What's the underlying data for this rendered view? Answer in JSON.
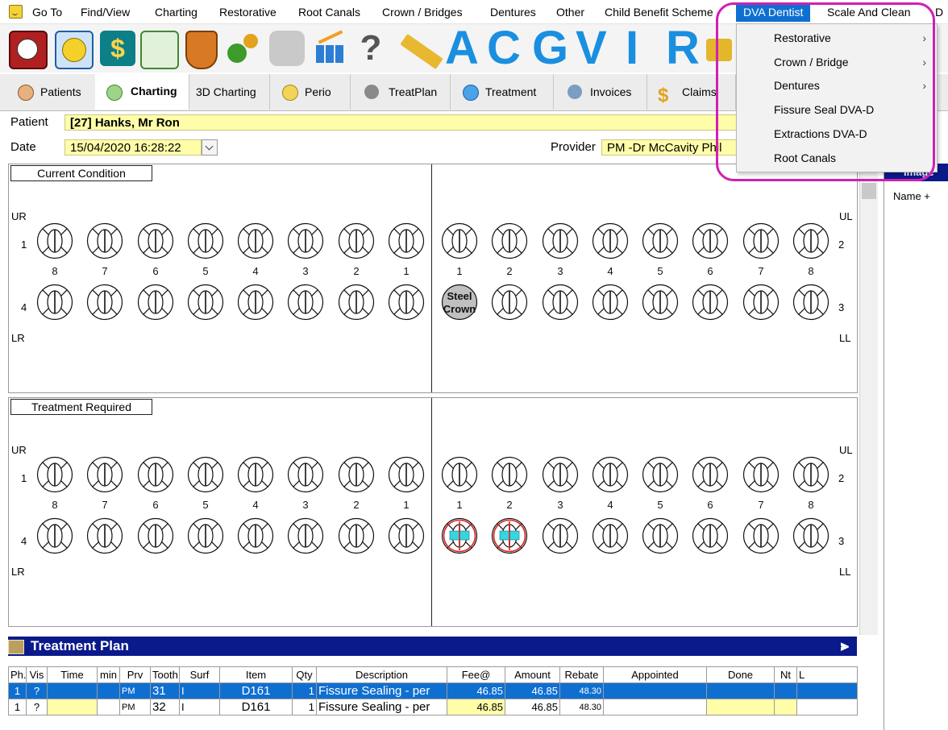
{
  "menubar": {
    "items": [
      "Go To",
      "Find/View",
      "Charting",
      "Restorative",
      "Root Canals",
      "Crown / Bridges",
      "Dentures",
      "Other",
      "Child Benefit Scheme",
      "DVA Dentist",
      "Scale And Clean",
      "D"
    ],
    "active": "DVA Dentist"
  },
  "toolbar": {
    "icons": [
      "appointment-clock-icon",
      "patient-smiley-icon",
      "billing-dollar-icon",
      "mail-icon",
      "shield-icon",
      "settings-gears-icon",
      "dental-teeth-icon",
      "report-chart-icon",
      "help-question-icon",
      "pencil-icon",
      "crown-icon"
    ],
    "letters": [
      "A",
      "C",
      "G",
      "V",
      "I",
      "R"
    ]
  },
  "tabs": [
    {
      "label": "Patients",
      "icon": "patient-person-icon"
    },
    {
      "label": "Charting",
      "icon": "tooth-green-icon",
      "active": true
    },
    {
      "label": "3D Charting"
    },
    {
      "label": "Perio",
      "icon": "tooth-yellow-icon"
    },
    {
      "label": "TreatPlan",
      "icon": "treatplan-icon"
    },
    {
      "label": "Treatment",
      "icon": "tooth-blue-icon"
    },
    {
      "label": "Invoices",
      "icon": "invoice-icon"
    },
    {
      "label": "Claims",
      "icon": "claims-dollar-icon"
    }
  ],
  "patient": {
    "label": "Patient",
    "value": "[27] Hanks, Mr Ron"
  },
  "date": {
    "label": "Date",
    "value": "15/04/2020 16:28:22"
  },
  "provider": {
    "label": "Provider",
    "value": "PM -Dr McCavity Phil"
  },
  "chart": {
    "current_title": "Current Condition",
    "required_title": "Treatment Required",
    "quadrants": {
      "ur": "UR",
      "ul": "UL",
      "lr": "LR",
      "ll": "LL"
    },
    "row_numbers": {
      "upper_right": "1",
      "upper_left": "2",
      "lower_left": "3",
      "lower_right": "4"
    },
    "tooth_numbers_right": [
      "8",
      "7",
      "6",
      "5",
      "4",
      "3",
      "2",
      "1"
    ],
    "tooth_numbers_left": [
      "1",
      "2",
      "3",
      "4",
      "5",
      "6",
      "7",
      "8"
    ],
    "steel_crown_line1": "Steel",
    "steel_crown_line2": "Crown",
    "marked_colors": {
      "crown": "#c0c0c0",
      "fissure_outline": "#e02020",
      "fissure_fill": "#34d7e0"
    }
  },
  "rightpane": {
    "title": "Image",
    "name_col": "Name +"
  },
  "treatment_plan": {
    "title": "Treatment Plan",
    "columns": [
      "Ph.",
      "Vis",
      "Time",
      "min",
      "Prv",
      "Tooth",
      "Surf",
      "Item",
      "Qty",
      "Description",
      "Fee@",
      "Amount",
      "Rebate",
      "Appointed",
      "Done",
      "Nt",
      "L"
    ],
    "rows": [
      {
        "ph": "1",
        "vis": "?",
        "time": "",
        "min": "",
        "prv": "PM",
        "tooth": "31",
        "surf": "I",
        "item": "D161",
        "qty": "1",
        "desc": "Fissure Sealing - per",
        "fee": "46.85",
        "amount": "46.85",
        "rebate": "48.30",
        "appointed": "",
        "done": "",
        "nt": "",
        "l": ""
      },
      {
        "ph": "1",
        "vis": "?",
        "time": "",
        "min": "",
        "prv": "PM",
        "tooth": "32",
        "surf": "I",
        "item": "D161",
        "qty": "1",
        "desc": "Fissure Sealing - per",
        "fee": "46.85",
        "amount": "46.85",
        "rebate": "48.30",
        "appointed": "",
        "done": "",
        "nt": "",
        "l": ""
      }
    ]
  },
  "dropdown": {
    "items": [
      {
        "label": "Restorative",
        "submenu": true
      },
      {
        "label": "Crown / Bridge",
        "submenu": true
      },
      {
        "label": "Dentures",
        "submenu": true
      },
      {
        "label": "Fissure Seal DVA-D",
        "submenu": false
      },
      {
        "label": "Extractions DVA-D",
        "submenu": false
      },
      {
        "label": "Root Canals",
        "submenu": false
      }
    ],
    "chevron": "›",
    "highlight_color": "#d01fb4"
  },
  "colors": {
    "accent": "#0f6fd1",
    "yellow_field": "#fffda8",
    "header_navy": "#0a1a8a"
  }
}
